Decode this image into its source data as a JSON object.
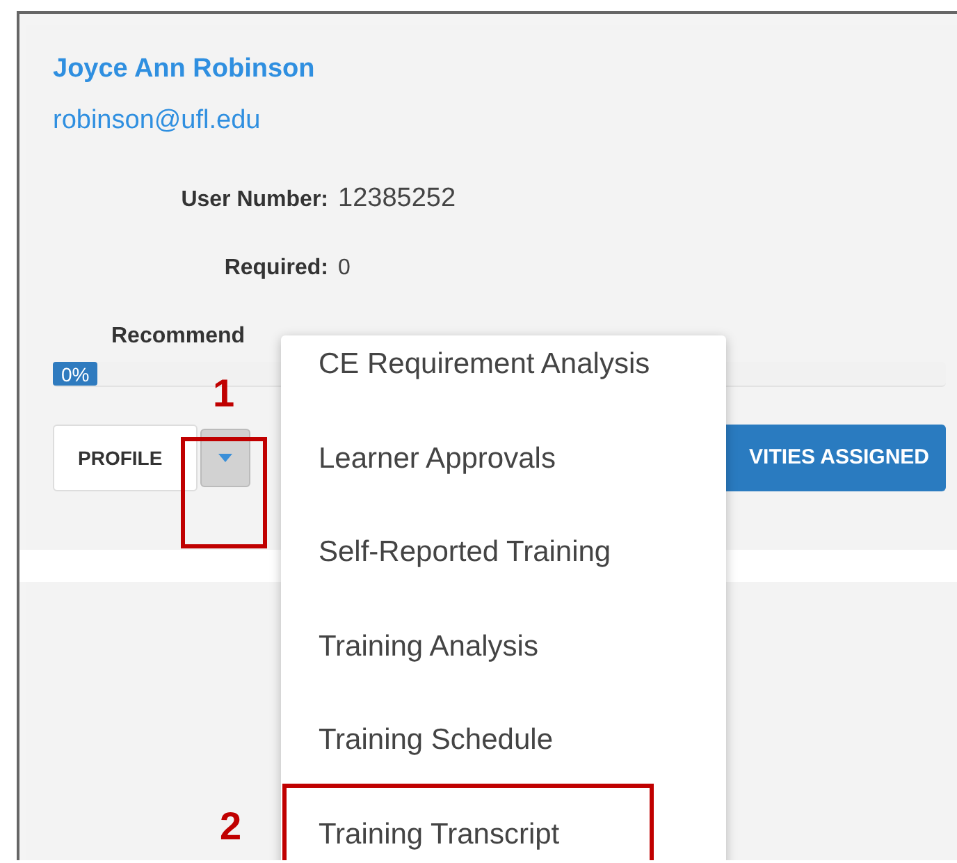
{
  "user": {
    "name": "Joyce Ann Robinson",
    "email": "robinson@ufl.edu"
  },
  "fields": [
    {
      "label": "User Number:",
      "value": "12385252"
    },
    {
      "label": "Required:",
      "value": "0"
    },
    {
      "label": "Recommend"
    }
  ],
  "progress": {
    "label": "0%",
    "level": 0
  },
  "buttons": {
    "profile": "PROFILE",
    "assigned": "VITIES ASSIGNED"
  },
  "menu": {
    "expanded": true,
    "items": [
      "CE Requirement Analysis",
      "Learner Approvals",
      "Self-Reported Training",
      "Training Analysis",
      "Training Schedule",
      "Training Transcript"
    ]
  },
  "annotations": [
    {
      "label": "1"
    },
    {
      "label": "2"
    }
  ]
}
